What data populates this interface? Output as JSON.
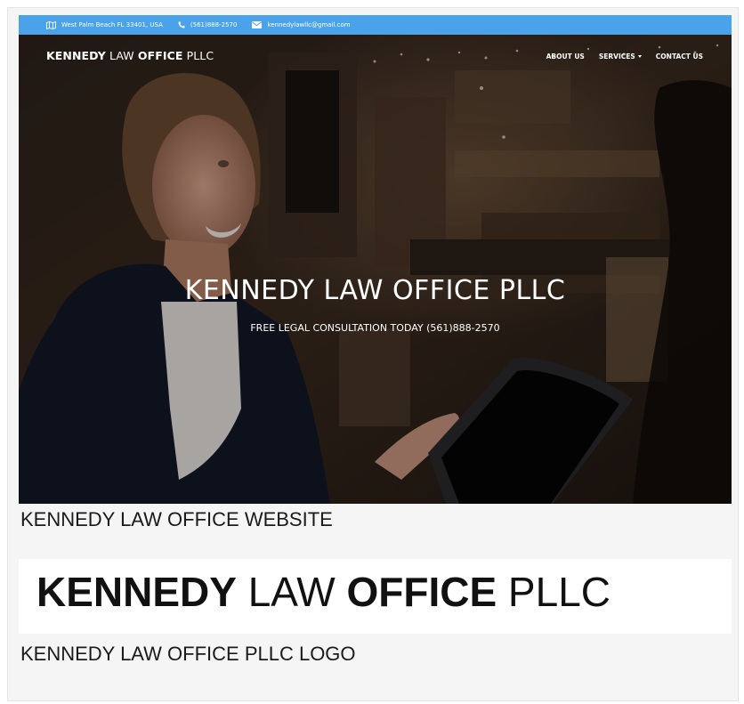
{
  "topbar": {
    "address": "West Palm Beach FL 33401, USA",
    "phone": "(561)888-2570",
    "email": "kennedylawllc@gmail.com",
    "background": "#4aa3ea"
  },
  "brand": {
    "part1": "KENNEDY",
    "part2": " LAW ",
    "part3": "OFFICE",
    "part4": " PLLC"
  },
  "nav": {
    "about": "ABOUT US",
    "services": "SERVICES",
    "contact": "CONTACT US"
  },
  "hero": {
    "title": "KENNEDY LAW OFFICE PLLC",
    "subtitle": "FREE LEGAL CONSULTATION TODAY (561)888-2570"
  },
  "captions": {
    "website": "KENNEDY LAW OFFICE WEBSITE",
    "logo": "KENNEDY LAW OFFICE PLLC LOGO"
  },
  "logo": {
    "part1": "KENNEDY",
    "part2": " LAW ",
    "part3": "OFFICE",
    "part4": " PLLC"
  }
}
